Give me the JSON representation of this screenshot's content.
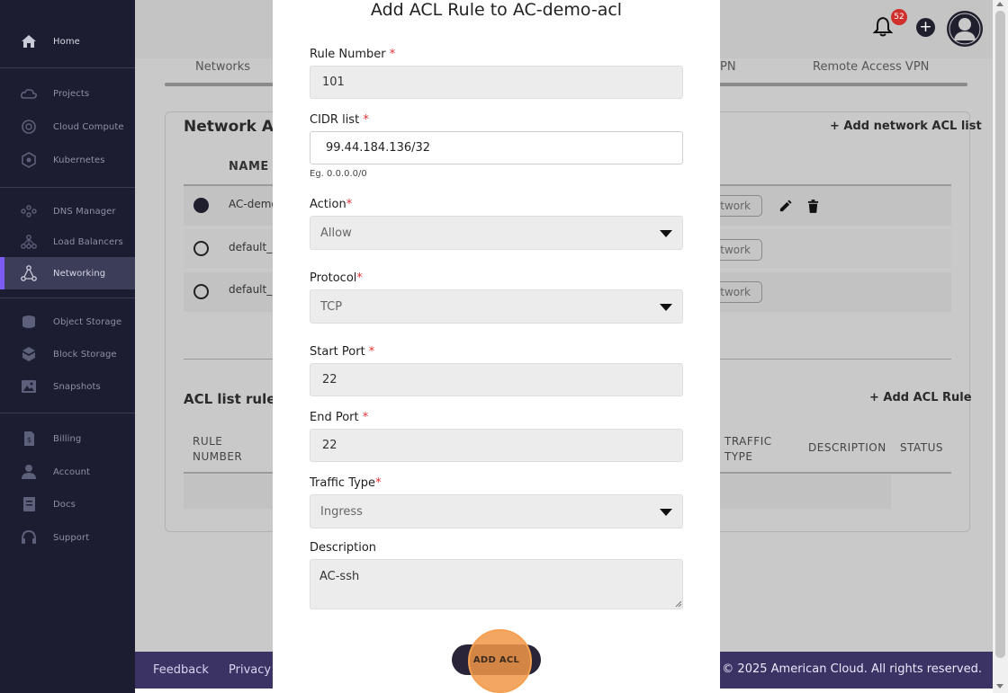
{
  "sidebar": {
    "items": [
      {
        "label": "Home",
        "icon": "home-icon"
      },
      {
        "label": "Projects",
        "icon": "cloud-icon"
      },
      {
        "label": "Cloud Compute",
        "icon": "cloud-compute-icon"
      },
      {
        "label": "Kubernetes",
        "icon": "kubernetes-icon"
      },
      {
        "label": "DNS Manager",
        "icon": "dns-icon"
      },
      {
        "label": "Load Balancers",
        "icon": "load-balancer-icon"
      },
      {
        "label": "Networking",
        "icon": "network-icon"
      },
      {
        "label": "Object Storage",
        "icon": "object-storage-icon"
      },
      {
        "label": "Block Storage",
        "icon": "block-storage-icon"
      },
      {
        "label": "Snapshots",
        "icon": "image-icon"
      },
      {
        "label": "Billing",
        "icon": "billing-icon"
      },
      {
        "label": "Account",
        "icon": "user-icon"
      },
      {
        "label": "Docs",
        "icon": "docs-icon"
      },
      {
        "label": "Support",
        "icon": "headset-icon"
      }
    ],
    "active": "Networking",
    "accent_color": "#7a5cf5"
  },
  "header": {
    "notification_count": "52"
  },
  "background": {
    "tabs": [
      "Networks",
      "PN",
      "Remote Access VPN"
    ],
    "acl_card_title": "Network ACL",
    "add_acl_list_label": "+ Add network ACL list",
    "name_header": "NAME",
    "rows": [
      {
        "name": "AC-demo",
        "btn": "twork",
        "selected": true
      },
      {
        "name": "default_a",
        "btn": "twork",
        "selected": false
      },
      {
        "name": "default_d",
        "btn": "twork",
        "selected": false
      }
    ],
    "rules_title": "ACL list rules : ",
    "add_rule_label": "+ Add ACL Rule",
    "rule_headers": {
      "rule_number": "RULE NUMBER",
      "traffic_type": "TRAFFIC TYPE",
      "description": "DESCRIPTION",
      "status": "STATUS"
    }
  },
  "modal": {
    "title": "Add ACL Rule to AC-demo-acl",
    "rule_number": {
      "label": "Rule Number ",
      "required": "*",
      "value": "101"
    },
    "cidr": {
      "label": "CIDR list ",
      "required": "*",
      "value": "99.44.184.136/32",
      "hint": "Eg. 0.0.0.0/0"
    },
    "action": {
      "label": "Action",
      "required": "*",
      "value": "Allow"
    },
    "protocol": {
      "label": "Protocol",
      "required": "*",
      "value": "TCP"
    },
    "start_port": {
      "label": "Start Port ",
      "required": "*",
      "value": "22"
    },
    "end_port": {
      "label": "End Port ",
      "required": "*",
      "value": "22"
    },
    "traffic_type": {
      "label": "Traffic Type",
      "required": "*",
      "value": "Ingress"
    },
    "description": {
      "label": "Description",
      "value": "AC-ssh"
    },
    "submit_label": "ADD ACL"
  },
  "footer": {
    "links": [
      "Feedback",
      "Privacy P"
    ],
    "copyright": "© 2025 American Cloud. All rights reserved."
  }
}
